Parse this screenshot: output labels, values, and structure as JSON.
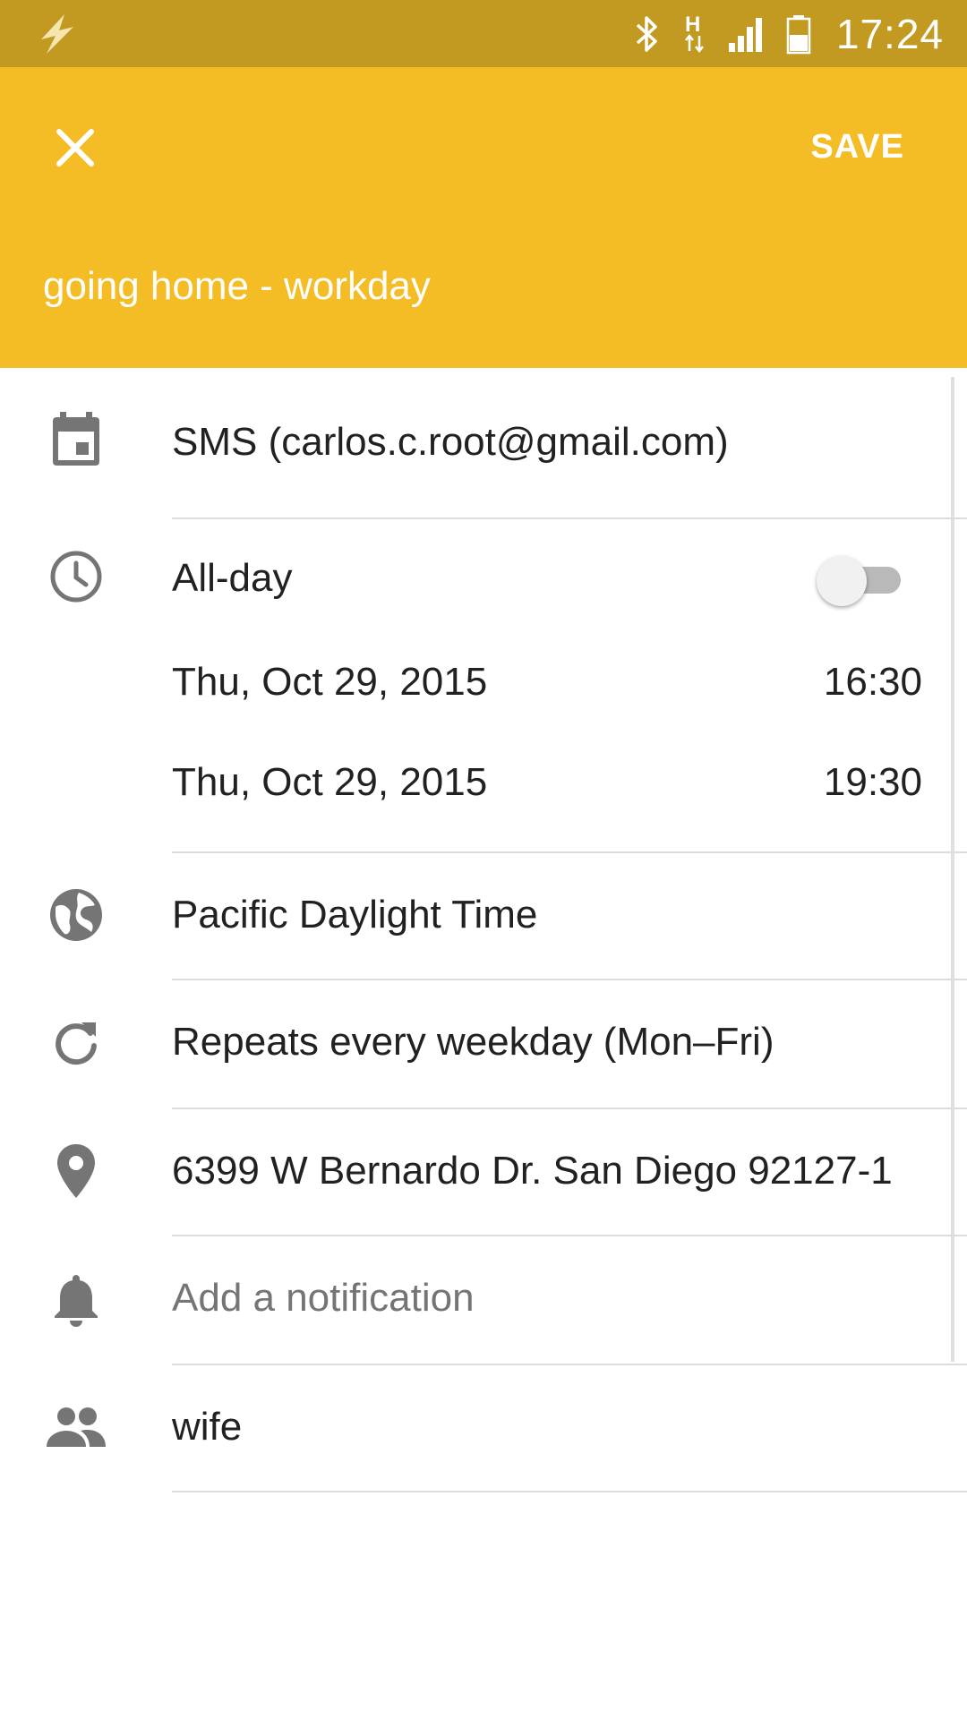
{
  "status_bar": {
    "time": "17:24",
    "network_label": "H",
    "icons": [
      "flash-icon",
      "bluetooth-icon",
      "network-h-icon",
      "signal-icon",
      "battery-icon"
    ]
  },
  "app_bar": {
    "close_icon": "close-icon",
    "save_label": "SAVE",
    "title": "going home - workday",
    "bg_color": "#f4bd26",
    "status_color": "#c29a21"
  },
  "event": {
    "calendar": "SMS (carlos.c.root@gmail.com)",
    "all_day_label": "All-day",
    "all_day_on": false,
    "start_date": "Thu, Oct 29, 2015",
    "start_time": "16:30",
    "end_date": "Thu, Oct 29, 2015",
    "end_time": "19:30",
    "timezone": "Pacific Daylight Time",
    "repeat": "Repeats every weekday (Mon–Fri)",
    "location": "6399 W Bernardo Dr. San Diego 92127-1",
    "notification_placeholder": "Add a notification",
    "guests": "wife"
  }
}
